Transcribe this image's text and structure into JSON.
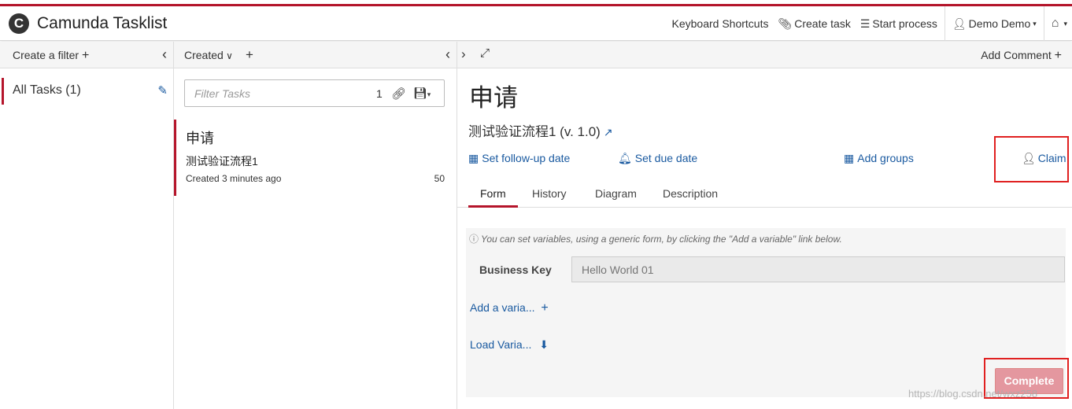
{
  "app": {
    "logo_letter": "C",
    "title": "Camunda Tasklist"
  },
  "nav": {
    "keyboard_shortcuts": "Keyboard Shortcuts",
    "create_task": "Create task",
    "start_process": "Start process",
    "user": "Demo Demo"
  },
  "filters": {
    "header": "Create a filter",
    "items": [
      {
        "label": "All Tasks (1)"
      }
    ]
  },
  "list": {
    "sort_label": "Created",
    "filter_placeholder": "Filter Tasks",
    "count": "1",
    "tasks": [
      {
        "name": "申请",
        "process": "测试验证流程1",
        "created": "Created 3 minutes ago",
        "priority": "50"
      }
    ]
  },
  "detail": {
    "add_comment": "Add Comment",
    "title": "申请",
    "process": "测试验证流程1 (v. 1.0)",
    "actions": {
      "follow_up": "Set follow-up date",
      "due": "Set due date",
      "groups": "Add groups",
      "claim": "Claim"
    },
    "tabs": [
      "Form",
      "History",
      "Diagram",
      "Description"
    ],
    "active_tab": "Form",
    "form": {
      "info": "You can set variables, using a generic form, by clicking the \"Add a variable\" link below.",
      "business_key_label": "Business Key",
      "business_key_placeholder": "Hello World 01",
      "add_variable": "Add a varia...",
      "load_variables": "Load Varia...",
      "complete": "Complete"
    }
  },
  "watermark": "https://blog.csdn.net/wxz258"
}
